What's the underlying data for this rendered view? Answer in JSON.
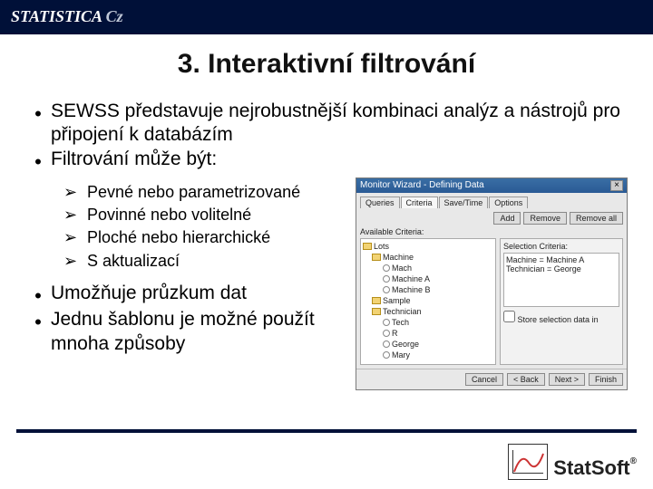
{
  "brand": {
    "main": "STATISTICA",
    "suffix": "Cz"
  },
  "title": "3. Interaktivní filtrování",
  "bullets": {
    "b1": "SEWSS představuje nejrobustnější kombinaci analýz a nástrojů pro připojení k databázím",
    "b2": "Filtrování může být:",
    "sub1": "Pevné nebo parametrizované",
    "sub2": "Povinné nebo volitelné",
    "sub3": "Ploché nebo hierarchické",
    "sub4": "S aktualizací",
    "b3": "Umožňuje průzkum dat",
    "b4": "Jednu šablonu je možné použít mnoha způsoby"
  },
  "dialog": {
    "title": "Monitor Wizard - Defining Data",
    "tabs": {
      "t1": "Queries",
      "t2": "Criteria",
      "t3": "Save/Time",
      "t4": "Options"
    },
    "buttons": {
      "add": "Add",
      "remove": "Remove",
      "removeall": "Remove all",
      "cancel": "Cancel",
      "back": "< Back",
      "next": "Next >",
      "finish": "Finish"
    },
    "labels": {
      "available": "Available Criteria:",
      "selection": "Selection Criteria:",
      "checkbox": "Store selection data in"
    },
    "tree": {
      "root": "Lots",
      "n1": "Machine",
      "n1a": "Mach",
      "n1b": "Machine A",
      "n1c": "Machine B",
      "n2": "Sample",
      "n3": "Technician",
      "n3a": "Tech",
      "n3b": "R",
      "n3c": "George",
      "n3d": "Mary"
    },
    "criteria": {
      "c1": "Machine = Machine A",
      "c2": "Technician = George"
    }
  },
  "logo": {
    "text": "StatSoft",
    "reg": "®"
  }
}
